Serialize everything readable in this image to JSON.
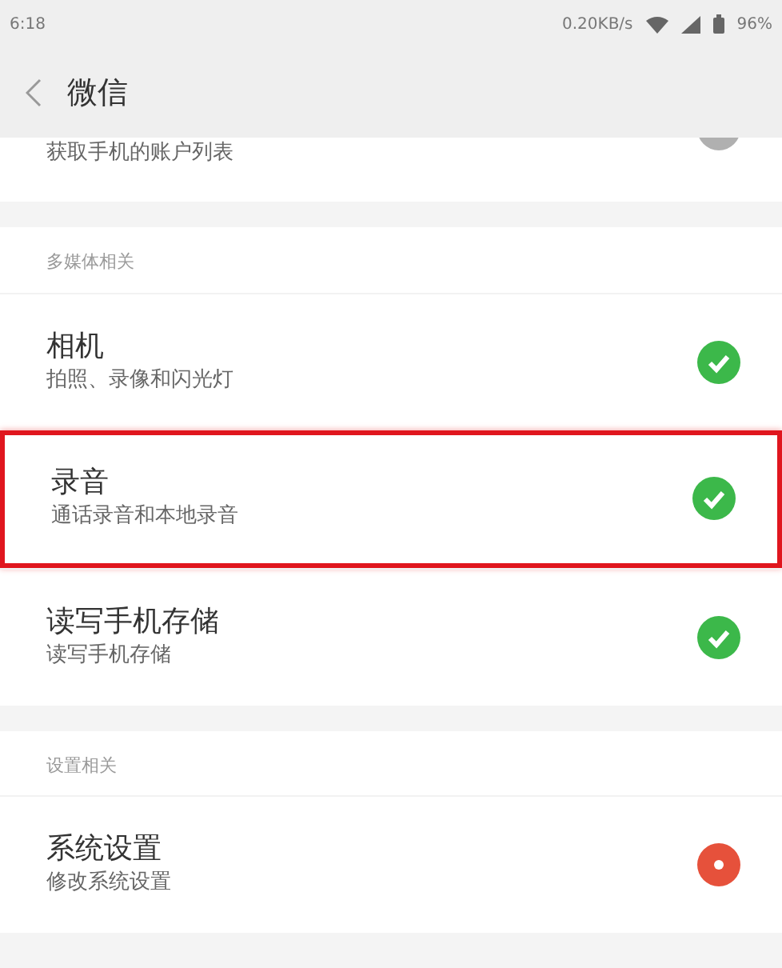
{
  "status_bar": {
    "time": "6:18",
    "speed": "0.20KB/s",
    "battery": "96%"
  },
  "header": {
    "title": "微信"
  },
  "sections": [
    {
      "items": [
        {
          "subtitle": "获取手机的账户列表",
          "kind": "neutral",
          "highlighted": false
        }
      ]
    },
    {
      "heading": "多媒体相关",
      "items": [
        {
          "title": "相机",
          "subtitle": "拍照、录像和闪光灯",
          "kind": "allowed",
          "highlighted": false
        },
        {
          "title": "录音",
          "subtitle": "通话录音和本地录音",
          "kind": "allowed",
          "highlighted": true
        },
        {
          "title": "读写手机存储",
          "subtitle": "读写手机存储",
          "kind": "allowed",
          "highlighted": false
        }
      ]
    },
    {
      "heading": "设置相关",
      "items": [
        {
          "title": "系统设置",
          "subtitle": "修改系统设置",
          "kind": "denied",
          "highlighted": false
        }
      ]
    }
  ]
}
